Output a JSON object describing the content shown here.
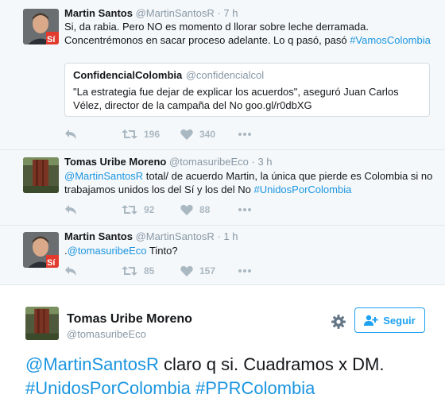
{
  "colors": {
    "link": "#1b95e0",
    "muted": "#8899a6",
    "action": "#aab8c2",
    "follow": "#1da1f2"
  },
  "tweets": [
    {
      "name": "Martin Santos",
      "handle": "@MartinSantosR",
      "time": "· 7 h",
      "text_lines": [
        "Si, da rabia. Pero NO es momento d llorar sobre leche derramada.",
        "Concentrémonos en sacar proceso adelante. Lo q pasó, pasó "
      ],
      "hashtag": "#VamosColombia",
      "quote": {
        "name": "ConfidencialColombia",
        "handle": "@confidencialcol",
        "text": "\"La estrategia fue dejar de explicar los acuerdos\", aseguró Juan Carlos Vélez, director de la campaña del No goo.gl/r0dbXG"
      },
      "retweets": "196",
      "likes": "340",
      "avatar_badge": "Sí"
    },
    {
      "name": "Tomas Uribe Moreno",
      "handle": "@tomasuribeEco",
      "time": "· 3 h",
      "mention": "@MartinSantosR",
      "text": " total/ de acuerdo Martin, la única que pierde es Colombia si no trabajamos unidos los del Sí y los del No ",
      "hashtag": "#UnidosPorColombia",
      "retweets": "92",
      "likes": "88"
    },
    {
      "name": "Martin Santos",
      "handle": "@MartinSantosR",
      "time": "· 1 h",
      "prefix": ".",
      "mention": "@tomasuribeEco",
      "text": " Tinto?",
      "retweets": "85",
      "likes": "157",
      "avatar_badge": "Sí"
    }
  ],
  "main": {
    "name": "Tomas Uribe Moreno",
    "handle": "@tomasuribeEco",
    "follow_label": "Seguir",
    "mention": "@MartinSantosR",
    "text": " claro q si. Cuadramos x DM.",
    "hashtag1": "#UnidosPorColombia",
    "hashtag2": "#PPRColombia"
  }
}
